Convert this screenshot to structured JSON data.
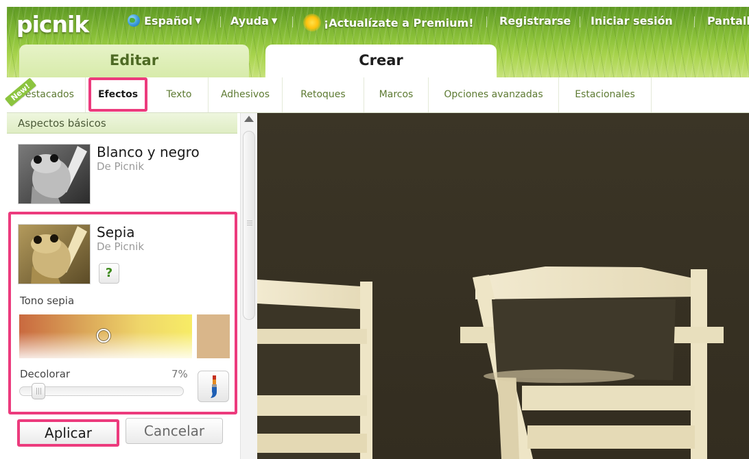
{
  "header": {
    "logo": "picnik",
    "nav": {
      "language": "Español",
      "help": "Ayuda",
      "premium": "¡Actualízate a Premium!",
      "register": "Registrarse",
      "login": "Iniciar sesión",
      "fullscreen": "Pantall"
    },
    "tabs": {
      "edit": "Editar",
      "create": "Crear"
    }
  },
  "subtabs": {
    "new_badge": "New!",
    "items": [
      "Destacados",
      "Efectos",
      "Texto",
      "Adhesivos",
      "Retoques",
      "Marcos",
      "Opciones avanzadas",
      "Estacionales"
    ],
    "active": "Efectos"
  },
  "panel": {
    "section_title": "Aspectos básicos",
    "effects": [
      {
        "title": "Blanco y negro",
        "subtitle": "De Picnik"
      },
      {
        "title": "Sepia",
        "subtitle": "De Picnik"
      }
    ],
    "sepia": {
      "help_label": "?",
      "tone_label": "Tono sepia",
      "decolorize_label": "Decolorar",
      "decolorize_value": "7%",
      "decolorize_fraction": 0.07,
      "swatch_color": "#d9b68a"
    },
    "apply_label": "Aplicar",
    "cancel_label": "Cancelar"
  },
  "colors": {
    "highlight": "#ec3b7d",
    "brand_green": "#8cc43f",
    "subtab_text": "#5d7a32"
  },
  "icons": [
    "globe-icon",
    "caret-down-icon",
    "sun-icon",
    "help-icon",
    "brush-icon",
    "scroll-up-icon"
  ]
}
